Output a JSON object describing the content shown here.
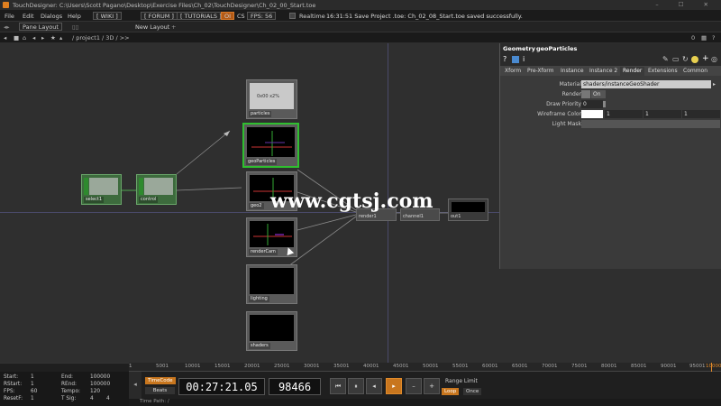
{
  "titlebar": {
    "text": "TouchDesigner: C:\\Users\\Scott Pagano\\Desktop\\Exercise Files\\Ch_02\\TouchDesigner\\Ch_02_00_Start.toe",
    "winbtns": "– ☐ ✕"
  },
  "menu": {
    "items": [
      "File",
      "Edit",
      "Dialogs",
      "Help"
    ],
    "wiki": "[ WIKI ]",
    "forum": "[ FORUM ]",
    "tutorials": "[ TUTORIALS ]",
    "oi": "OI",
    "cs": "CS",
    "fps": "FPS: 56",
    "realtime": "Realtime",
    "status": "16:31:51 Save Project .toe: Ch_02_08_Start.toe saved successfully."
  },
  "panebar": {
    "pane_layout": "Pane Layout",
    "new_layout": "New Layout",
    "plus": "+"
  },
  "pathbar": {
    "path": "/ project1 / 3D / >>",
    "zoom_label": "0"
  },
  "nodes": {
    "particles": "particles",
    "geoParticles": "geoParticles",
    "geo2": "geo2",
    "render": "render1",
    "chanel": "channel1",
    "out": "out1",
    "renderCam": "renderCam",
    "lighting": "lighting",
    "shaders": "shaders",
    "select": "select1",
    "control": "control",
    "particles_view": "0x00  x2%"
  },
  "watermark": "www.cgtsj.com",
  "params": {
    "header_type": "Geometry",
    "header_name": "geoParticles",
    "tabs": [
      "Xform",
      "Pre-Xform",
      "Instance",
      "Instance 2",
      "Render",
      "Extensions",
      "Common"
    ],
    "active_tab": "Render",
    "rows": [
      {
        "label": "Material",
        "value": "shaders/instanceGeoShader"
      },
      {
        "label": "Render",
        "value": "On"
      },
      {
        "label": "Draw Priority",
        "value": "0"
      },
      {
        "label": "Wireframe Color",
        "value": "",
        "r": "1",
        "g": "1",
        "b": "1"
      },
      {
        "label": "Light Mask",
        "value": ""
      }
    ]
  },
  "stats": {
    "start_label": "Start:",
    "start": "1",
    "rstart_label": "RStart:",
    "rstart": "1",
    "fps_label": "FPS:",
    "fps": "60",
    "reset_label": "ResetF:",
    "reset": "1",
    "end_label": "End:",
    "end": "100000",
    "rend_label": "REnd:",
    "rend": "100000",
    "tempo_label": "Tempo:",
    "tempo": "120",
    "tsig_label": "T Sig:",
    "tsig_a": "4",
    "tsig_b": "4"
  },
  "ruler": [
    "1",
    "5001",
    "10001",
    "15001",
    "20001",
    "25001",
    "30001",
    "35001",
    "40001",
    "45001",
    "50001",
    "55001",
    "60001",
    "65001",
    "70001",
    "75001",
    "80001",
    "85001",
    "90001",
    "95001",
    "100000"
  ],
  "transport": {
    "timecode": "TimeCode",
    "beats": "Beats",
    "time": "00:27:21.05",
    "frame": "98466",
    "range_limit": "Range Limit",
    "loop": "Loop",
    "once": "Once",
    "time_path": "Time Path: /"
  },
  "colors": {
    "accent": "#c8761e",
    "network_bg": "#2f2f2f",
    "selected": "#2fbf2f"
  }
}
